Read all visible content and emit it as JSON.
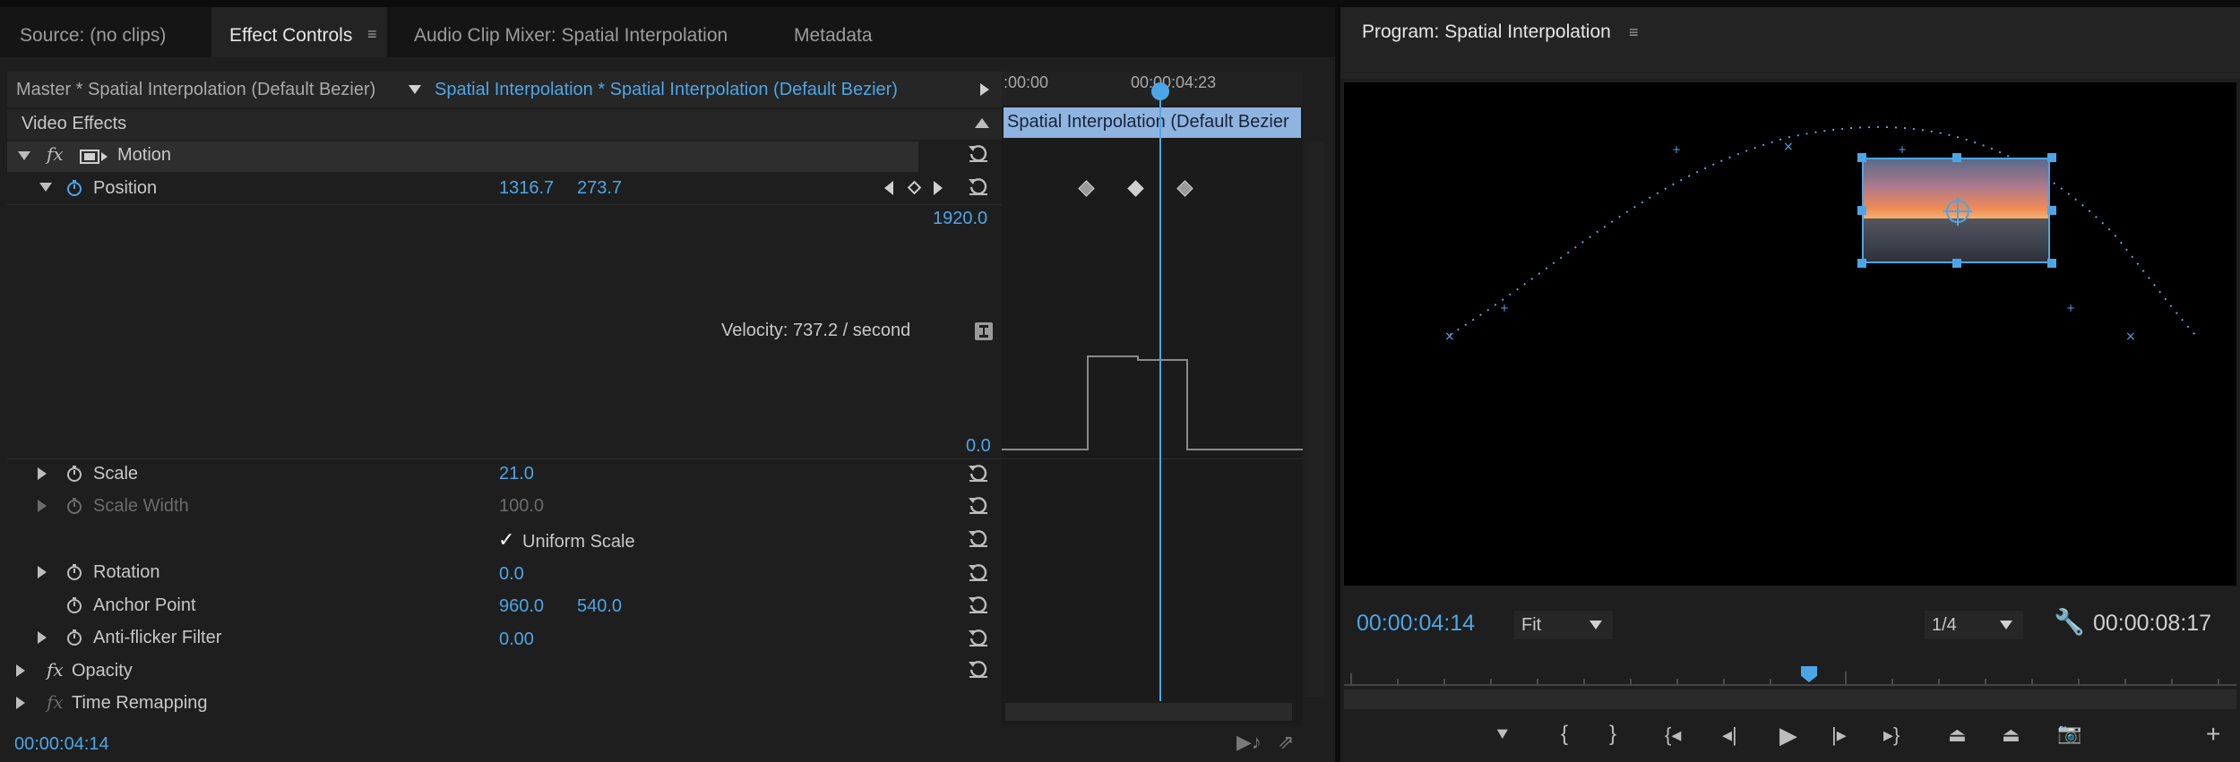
{
  "left_tabs": [
    {
      "label": "Source: (no clips)"
    },
    {
      "label": "Effect Controls",
      "active": true
    },
    {
      "label": "Audio Clip Mixer: Spatial Interpolation"
    },
    {
      "label": "Metadata"
    }
  ],
  "effect_controls": {
    "master_label": "Master * Spatial Interpolation (Default Bezier)",
    "clip_label": "Spatial Interpolation * Spatial Interpolation (Default Bezier)",
    "section_title": "Video Effects",
    "timeline": {
      "time_start": ":00:00",
      "time_marker": "00:00:04:23",
      "clip_bar_label": "Spatial Interpolation (Default Bezier",
      "graph_max": "1920.0",
      "graph_min": "0.0"
    },
    "motion_label": "Motion",
    "position": {
      "label": "Position",
      "x": "1316.7",
      "y": "273.7"
    },
    "velocity_text": "Velocity: 737.2 / second",
    "scale": {
      "label": "Scale",
      "value": "21.0"
    },
    "scale_width": {
      "label": "Scale Width",
      "value": "100.0"
    },
    "uniform_scale": {
      "label": "Uniform Scale",
      "checked": true
    },
    "rotation": {
      "label": "Rotation",
      "value": "0.0"
    },
    "anchor_point": {
      "label": "Anchor Point",
      "x": "960.0",
      "y": "540.0"
    },
    "anti_flicker": {
      "label": "Anti-flicker Filter",
      "value": "0.00"
    },
    "opacity_label": "Opacity",
    "time_remapping_label": "Time Remapping",
    "current_time": "00:00:04:14"
  },
  "program": {
    "title": "Program: Spatial Interpolation",
    "current_time": "00:00:04:14",
    "fit_label": "Fit",
    "resolution_label": "1/4",
    "duration": "00:00:08:17",
    "colors": {
      "accent": "#4ca6e6",
      "sky_top": "#5b6a8a",
      "sky_glow": "#f08a55",
      "ground": "#3a3f4a"
    }
  },
  "icons": [
    "fx-icon",
    "stopwatch-icon",
    "reset-icon",
    "keyframe-icon",
    "menu-icon",
    "wrench-icon",
    "play-icon",
    "camera-icon",
    "plus-icon"
  ]
}
